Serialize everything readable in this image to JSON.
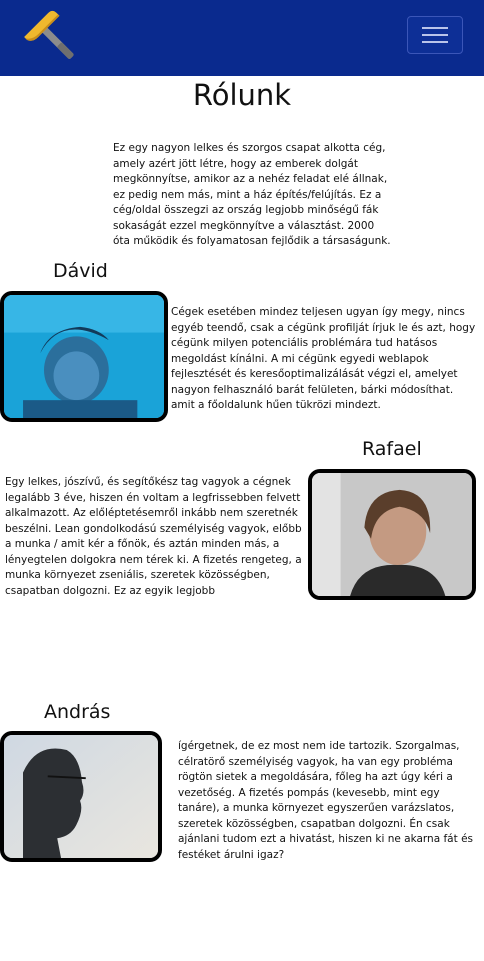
{
  "navbar": {
    "logo_icon": "hammer-icon",
    "menu_icon": "hamburger-menu-icon",
    "colors": {
      "background": "#0a2a8e"
    }
  },
  "page": {
    "title": "Rólunk",
    "intro": "Ez egy nagyon lelkes és szorgos csapat alkotta cég, amely azért jött létre, hogy az emberek dolgát megkönnyítse, amikor az a nehéz feladat elé állnak, ez pedig nem más, mint a ház építés/felújítás. Ez a cég/oldal összegzi az ország legjobb minőségű fák sokaságát ezzel megkönnyítve a választást. 2000 óta működik és folyamatosan fejlődik a társaságunk."
  },
  "members": [
    {
      "name": "Dávid",
      "bio": "Cégek esetében mindez teljesen ugyan így megy, nincs egyéb teendő, csak a cégünk profilját írjuk le és azt, hogy cégünk milyen potenciális problémára tud hatásos megoldást kínálni. A mi cégünk egyedi weblapok fejlesztését és keresőoptimalizálását végzi el, amelyet nagyon felhasználó barát felületen, bárki módosíthat. amit a főoldalunk hűen tükrözi mindezt."
    },
    {
      "name": "Rafael",
      "bio": "Egy lelkes, jószívű, és segítőkész tag vagyok a cégnek legalább 3 éve, hiszen én voltam a legfrissebben felvett alkalmazott. Az előléptetésemről inkább nem szeretnék beszélni. Lean gondolkodású személyiség vagyok, előbb a munka / amit kér a főnök, és aztán minden más, a lényegtelen dolgokra nem térek ki. A fizetés rengeteg, a munka környezet zseniális, szeretek közösségben, csapatban dolgozni.  Ez az egyik legjobb"
    },
    {
      "name": "András",
      "bio": "ígérgetnek, de ez most nem ide tartozik. Szorgalmas, célratörő személyiség vagyok, ha van egy probléma rögtön sietek a megoldására, főleg ha azt úgy kéri a vezetőség. A fizetés pompás (kevesebb, mint egy tanáre), a munka környezet egyszerűen varázslatos, szeretek közösségben, csapatban dolgozni. Én csak ajánlani tudom ezt a hivatást, hiszen ki ne akarna fát és festéket árulni igaz?"
    }
  ]
}
